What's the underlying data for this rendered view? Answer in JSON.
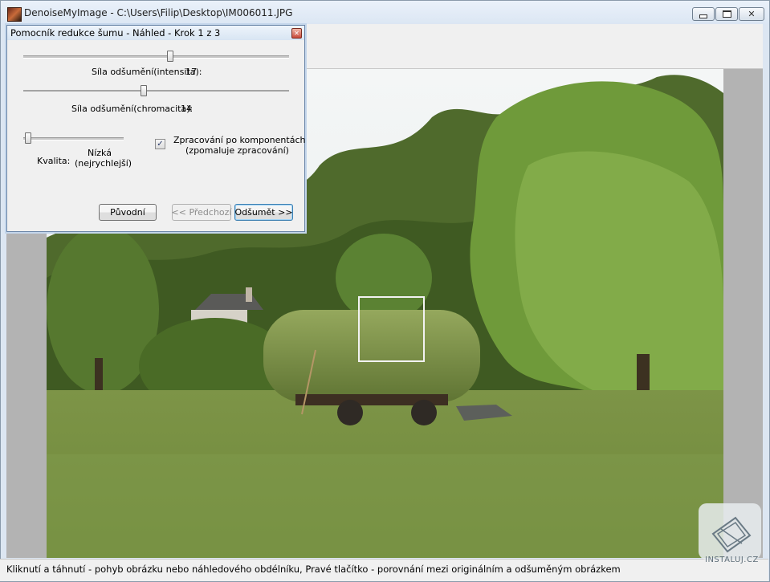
{
  "window": {
    "title": "DenoiseMyImage - C:\\Users\\Filip\\Desktop\\IM006011.JPG",
    "app_icon": "app-icon",
    "min_icon": "minimize-icon",
    "max_icon": "maximize-icon",
    "close_icon": "close-icon",
    "close_glyph": "✕"
  },
  "dialog": {
    "title": "Pomocník redukce šumu - Náhled - Krok 1 z 3",
    "close_glyph": "✕",
    "intensity": {
      "label": "Síla odšumění(intensita):",
      "value": "17",
      "level": 0.55
    },
    "chromacity": {
      "label": "Síla odšumění(chromacita):",
      "value": "14",
      "level": 0.45
    },
    "quality": {
      "label": "Kvalita:",
      "value_line1": "Nízká",
      "value_line2": "(nejrychlejší)",
      "level": 0.0
    },
    "per_component": {
      "checked": true,
      "check_glyph": "✓",
      "label_line1": "Zpracování po komponentách",
      "label_line2": "(zpomaluje zpracování)"
    },
    "buttons": {
      "original": "Původní",
      "previous": "<< Předchozí",
      "next": "Odšumět >>"
    }
  },
  "status_bar": {
    "text": "Kliknutí a táhnutí - pohyb obrázku nebo náhledového obdélníku, Pravé tlačítko - porovnání mezi originálním a odšuměným obrázkem"
  },
  "watermark": {
    "text": "INSTALUJ.CZ"
  }
}
